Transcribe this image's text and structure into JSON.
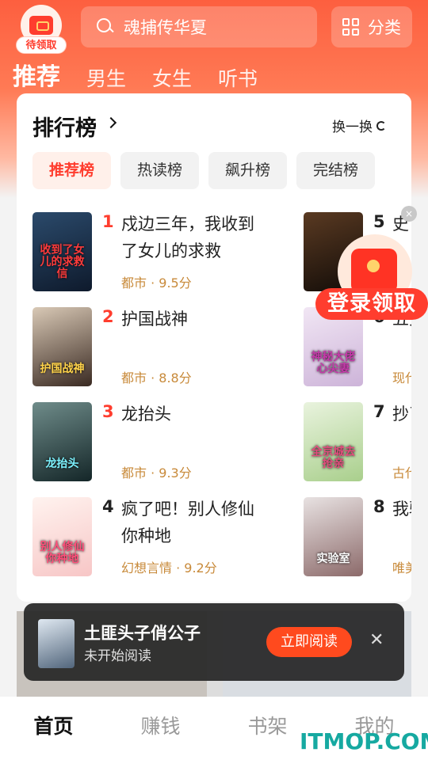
{
  "header": {
    "gift_badge": "待领取",
    "search_text": "魂捕传华夏",
    "category_label": "分类",
    "tabs": [
      "推荐",
      "男生",
      "女生",
      "听书"
    ]
  },
  "ranking": {
    "title": "排行榜",
    "refresh_label": "换一换",
    "tabs": [
      "推荐榜",
      "热读榜",
      "飙升榜",
      "完结榜"
    ],
    "books": [
      {
        "rank": "1",
        "title": "戍边三年，我收到了女儿的求救",
        "meta": "都市 · 9.5分",
        "cover_text": "收到了女儿的求救信"
      },
      {
        "rank": "2",
        "title": "护国战神",
        "meta": "都市 · 8.8分",
        "cover_text": "护国战神"
      },
      {
        "rank": "3",
        "title": "龙抬头",
        "meta": "都市 · 9.3分",
        "cover_text": "龙抬头"
      },
      {
        "rank": "4",
        "title": "疯了吧！别人修仙你种地",
        "meta": "幻想言情 · 9.2分",
        "cover_text": "别人修仙你种地"
      },
      {
        "rank": "5",
        "title": "史",
        "meta": "",
        "cover_text": ""
      },
      {
        "rank": "6",
        "title": "五大",
        "meta": "现代",
        "cover_text": "神秘大佬心尖妻"
      },
      {
        "rank": "7",
        "title": "抄了",
        "meta": "古代",
        "cover_text": "全京城去抢亲"
      },
      {
        "rank": "8",
        "title": "我验",
        "meta": "唯美",
        "cover_text": "实验室"
      }
    ]
  },
  "promo": {
    "label": "登录领取",
    "close_glyph": "×"
  },
  "reading_bar": {
    "title": "土匪头子俏公子",
    "subtitle": "未开始阅读",
    "button": "立即阅读",
    "close_glyph": "✕"
  },
  "bottom_nav": [
    "首页",
    "赚钱",
    "书架",
    "我的"
  ],
  "watermark": "ITMOP.COM",
  "colors": {
    "accent": "#ff3d2e",
    "meta": "#c88a3a",
    "header_top": "#fd5f3f"
  }
}
